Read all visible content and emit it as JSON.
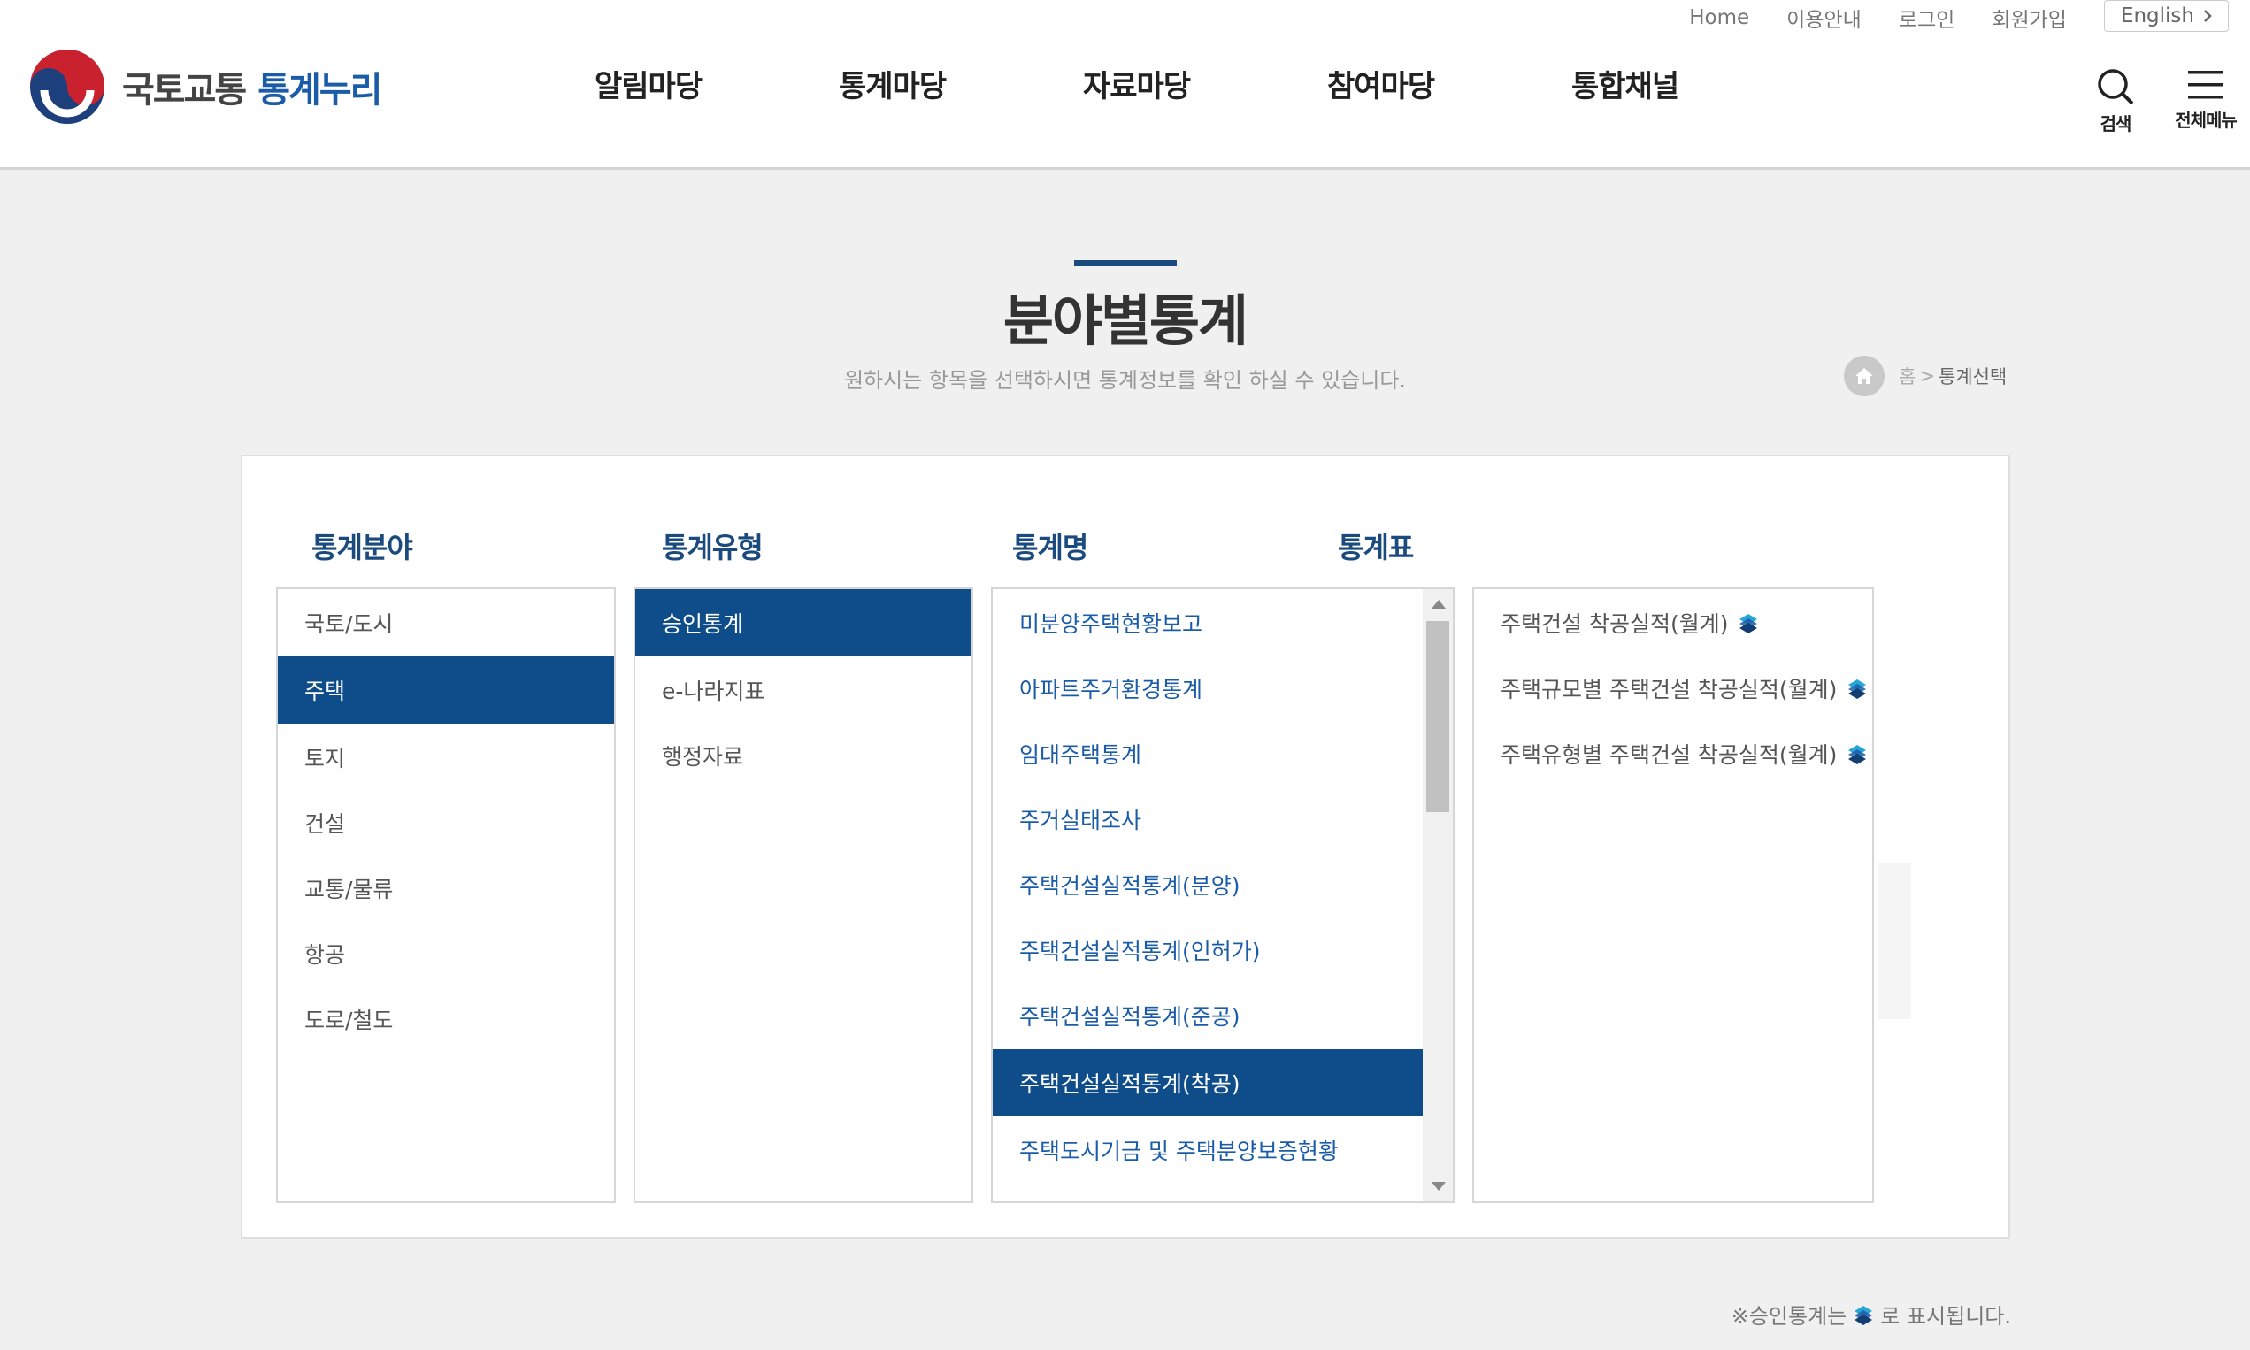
{
  "header": {
    "util": {
      "home": "Home",
      "guide": "이용안내",
      "login": "로그인",
      "join": "회원가입",
      "lang": "English"
    },
    "logo": {
      "part1": "국토교통",
      "part2": "통계누리"
    },
    "gnb": [
      "알림마당",
      "통계마당",
      "자료마당",
      "참여마당",
      "통합채널"
    ],
    "search_label": "검색",
    "menu_label": "전체메뉴"
  },
  "page": {
    "title": "분야별통계",
    "subtitle": "원하시는 항목을 선택하시면 통계정보를 확인 하실 수 있습니다.",
    "breadcrumb": {
      "home": "홈",
      "sep": ">",
      "current": "통계선택"
    }
  },
  "columns": {
    "field_title": "통계분야",
    "type_title": "통계유형",
    "name_title": "통계명",
    "table_title": "통계표"
  },
  "fields": {
    "items": [
      "국토/도시",
      "주택",
      "토지",
      "건설",
      "교통/물류",
      "항공",
      "도로/철도"
    ],
    "selected": "주택"
  },
  "types": {
    "items": [
      "승인통계",
      "e-나라지표",
      "행정자료"
    ],
    "selected": "승인통계"
  },
  "names": {
    "items": [
      "미분양주택현황보고",
      "아파트주거환경통계",
      "임대주택통계",
      "주거실태조사",
      "주택건설실적통계(분양)",
      "주택건설실적통계(인허가)",
      "주택건설실적통계(준공)",
      "주택건설실적통계(착공)",
      "주택도시기금 및 주택분양보증현황"
    ],
    "selected": "주택건설실적통계(착공)"
  },
  "tables": {
    "items": [
      "주택건설 착공실적(월계)",
      "주택규모별 주택건설 착공실적(월계)",
      "주택유형별 주택건설 착공실적(월계)"
    ],
    "badge_icon": "approved-stat-icon"
  },
  "footer_note": {
    "before": "※승인통계는",
    "after": "로 표시됩니다."
  },
  "colors": {
    "accent": "#0f4d8a",
    "link": "#1b5ca8",
    "title_bar": "#1a4a7e"
  }
}
